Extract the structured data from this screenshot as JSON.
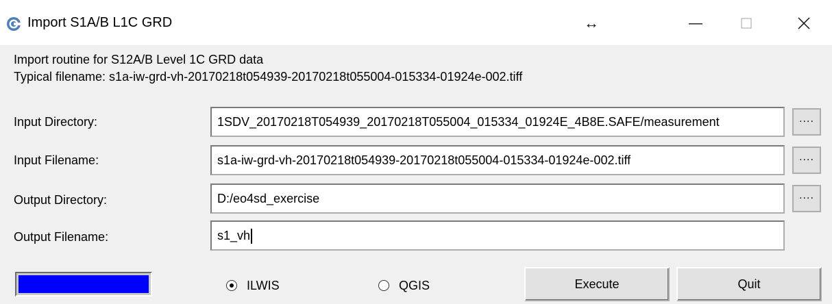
{
  "window": {
    "title": "Import S1A/B L1C GRD",
    "controls": {
      "resize": "↔",
      "minimize": "—",
      "maximize": "☐",
      "close": "✕"
    },
    "icon": "satellite-app-icon"
  },
  "description": {
    "line1": "Import routine for S12A/B Level 1C GRD data",
    "line2": "Typical filename: s1a-iw-grd-vh-20170218t054939-20170218t055004-015334-01924e-002.tiff"
  },
  "form": {
    "input_directory": {
      "label": "Input Directory:",
      "value": "1SDV_20170218T054939_20170218T055004_015334_01924E_4B8E.SAFE/measurement"
    },
    "input_filename": {
      "label": "Input Filename:",
      "value": "s1a-iw-grd-vh-20170218t054939-20170218t055004-015334-01924e-002.tiff"
    },
    "output_directory": {
      "label": "Output Directory:",
      "value": "D:/eo4sd_exercise"
    },
    "output_filename": {
      "label": "Output Filename:",
      "value": "s1_vh"
    },
    "browse_label": "...."
  },
  "footer": {
    "progress": 1.0,
    "radio_options": [
      {
        "label": "ILWIS",
        "checked": true
      },
      {
        "label": "QGIS",
        "checked": false
      }
    ],
    "execute_label": "Execute",
    "quit_label": "Quit"
  },
  "colors": {
    "progress": "#0000ff",
    "window_bg": "#f0f0f0"
  }
}
